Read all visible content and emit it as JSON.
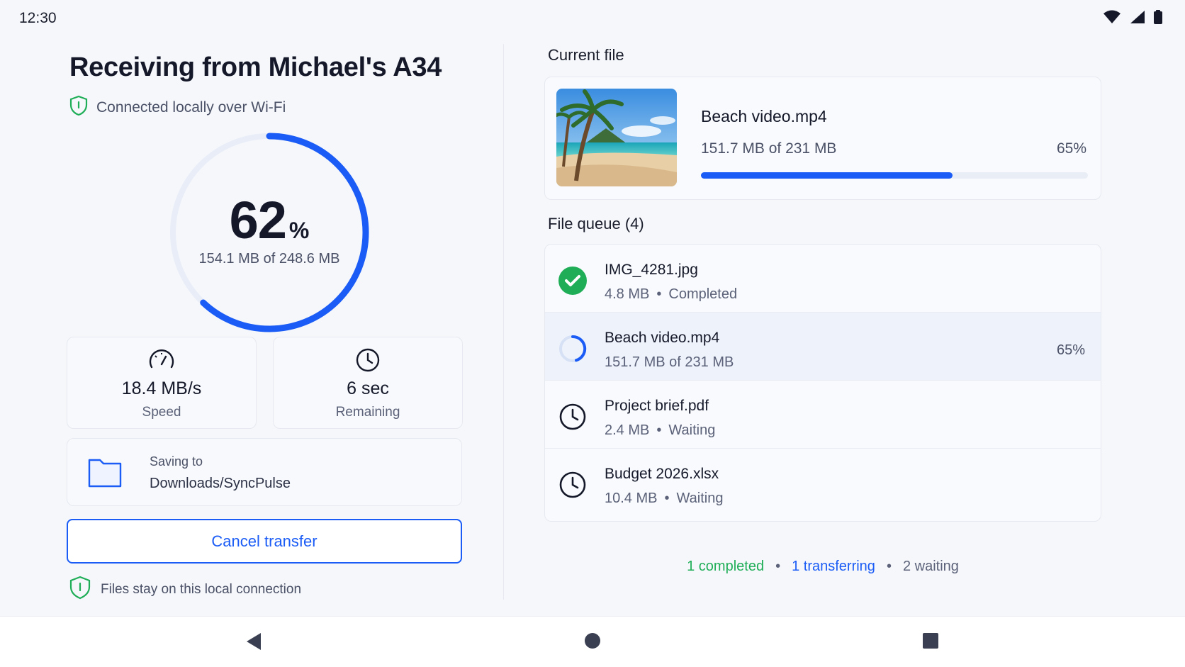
{
  "status_bar": {
    "time": "12:30",
    "icons": [
      "wifi-icon",
      "signal-icon",
      "battery-icon"
    ]
  },
  "header": {
    "title": "Receiving from Michael's A34",
    "connection_text": "Connected locally over Wi-Fi"
  },
  "overall_progress": {
    "percent_value": "62",
    "percent_symbol": "%",
    "fraction": 0.62,
    "size_text": "154.1 MB of 248.6 MB"
  },
  "stats": {
    "speed": {
      "value": "18.4 MB/s",
      "label": "Speed"
    },
    "remaining": {
      "value": "6 sec",
      "label": "Remaining"
    }
  },
  "save_location": {
    "label": "Saving to",
    "path": "Downloads/SyncPulse"
  },
  "cancel_button": {
    "label": "Cancel transfer"
  },
  "footer_note": "Files stay on this local connection",
  "current_file": {
    "section_label": "Current file",
    "name": "Beach video.mp4",
    "size_text": "151.7 MB of 231 MB",
    "percent_text": "65%",
    "fraction": 0.65
  },
  "queue": {
    "section_label": "File queue (4)",
    "items": [
      {
        "name": "IMG_4281.jpg",
        "size": "4.8 MB",
        "dot": "•",
        "status": "Completed",
        "icon": "check-circle-icon"
      },
      {
        "name": "Beach video.mp4",
        "size": "151.7 MB of 231 MB",
        "percent": "65%",
        "icon": "spinner-icon"
      },
      {
        "name": "Project brief.pdf",
        "size": "2.4 MB",
        "dot": "•",
        "status": "Waiting",
        "icon": "clock-icon"
      },
      {
        "name": "Budget 2026.xlsx",
        "size": "10.4 MB",
        "dot": "•",
        "status": "Waiting",
        "icon": "clock-icon"
      }
    ]
  },
  "summary": {
    "completed": "1 completed",
    "transferring": "1 transferring",
    "waiting": "2 waiting",
    "dot": "•"
  },
  "colors": {
    "accent": "#1a5cf5",
    "success": "#1fae57",
    "text": "#141829"
  }
}
